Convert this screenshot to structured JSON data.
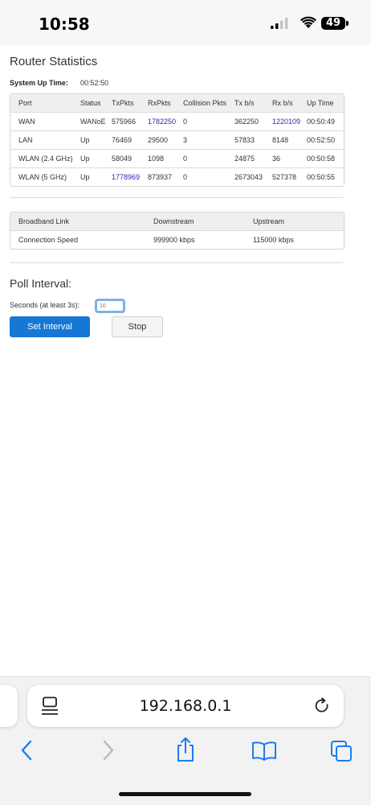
{
  "status_bar": {
    "time": "10:58",
    "battery": "49"
  },
  "page": {
    "title": "Router Statistics",
    "uptime_label": "System Up Time:",
    "uptime_value": "00:52:50"
  },
  "stats_table": {
    "headers": [
      "Port",
      "Status",
      "TxPkts",
      "RxPkts",
      "Collision Pkts",
      "Tx b/s",
      "Rx b/s",
      "Up Time"
    ],
    "rows": [
      [
        "WAN",
        "WANoE",
        "575966",
        "1782250",
        "0",
        "362250",
        "1220109",
        "00:50:49"
      ],
      [
        "LAN",
        "Up",
        "76469",
        "29500",
        "3",
        "57833",
        "8148",
        "00:52:50"
      ],
      [
        "WLAN (2.4 GHz)",
        "Up",
        "58049",
        "1098",
        "0",
        "24875",
        "36",
        "00:50:58"
      ],
      [
        "WLAN (5 GHz)",
        "Up",
        "1778969",
        "873937",
        "0",
        "2673043",
        "527378",
        "00:50:55"
      ]
    ]
  },
  "broadband_table": {
    "headers": [
      "Broadband Link",
      "Downstream",
      "Upstream"
    ],
    "rows": [
      [
        "Connection Speed",
        "999900 kbps",
        "115000 kbps"
      ]
    ]
  },
  "poll": {
    "title": "Poll Interval:",
    "seconds_label": "Seconds (at least 3s):",
    "seconds_placeholder": "10",
    "set_button": "Set Interval",
    "stop_button": "Stop"
  },
  "safari": {
    "url": "192.168.0.1"
  },
  "colors": {
    "link": "#2a2aa8",
    "primary_button": "#1478d4",
    "focus_ring": "#7fb0e8",
    "ios_tint": "#1a7cf5"
  },
  "icons": {
    "page_menu": "page-menu-icon",
    "reload": "reload-icon",
    "back": "back-chevron-icon",
    "forward": "forward-chevron-icon",
    "share": "share-icon",
    "bookmarks": "book-icon",
    "tabs": "tabs-icon"
  }
}
